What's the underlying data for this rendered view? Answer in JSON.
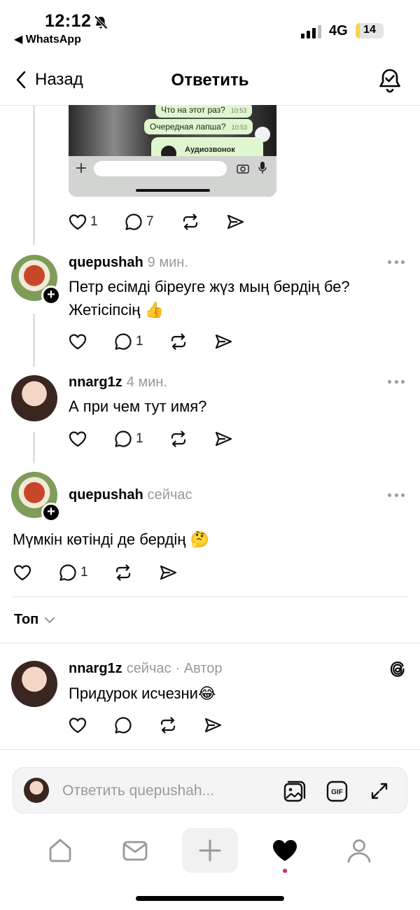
{
  "status_bar": {
    "time": "12:12",
    "back_app": "◀ WhatsApp",
    "network": "4G",
    "battery": "14",
    "battery_fraction": 0.14
  },
  "nav": {
    "back_label": "Назад",
    "title": "Ответить"
  },
  "shared_image": {
    "bubble1": "Что на этот раз?",
    "bubble1_time": "10:53",
    "bubble2": "Очередная лапша?",
    "bubble2_time": "10:53",
    "call_label": "Аудиозвонок"
  },
  "first_post_actions": {
    "likes": "1",
    "replies": "7"
  },
  "posts": [
    {
      "username": "quepushah",
      "time": "9 мин.",
      "text_line1": "Петр есімді біреуге жүз мың бердің бе?",
      "text_line2": "Жетісіпсің 👍",
      "replies": "1"
    },
    {
      "username": "nnarg1z",
      "time": "4 мин.",
      "text": "А при чем тут имя?",
      "replies": "1"
    },
    {
      "username": "quepushah",
      "time": "сейчас",
      "text": "Мүмкін көтінді де бердің 🤔",
      "replies": "1"
    }
  ],
  "sort": {
    "label": "Топ"
  },
  "reply": {
    "username": "nnarg1z",
    "time": "сейчас",
    "author_tag": "· Автор",
    "text": "Придурок исчезни😂"
  },
  "composer": {
    "placeholder": "Ответить quepushah..."
  },
  "icons": {
    "accent_red": "#e0245e"
  }
}
